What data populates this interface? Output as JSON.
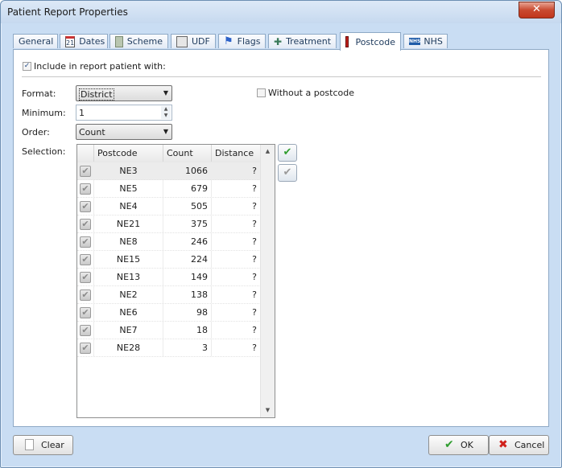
{
  "window": {
    "title": "Patient Report Properties",
    "close_glyph": "✕"
  },
  "tabs": [
    {
      "label": "General",
      "icon": "none"
    },
    {
      "label": "Dates",
      "icon": "calendar-icon",
      "icon_text": "21"
    },
    {
      "label": "Scheme",
      "icon": "scheme-icon"
    },
    {
      "label": "UDF",
      "icon": "udf-icon"
    },
    {
      "label": "Flags",
      "icon": "flag-icon"
    },
    {
      "label": "Treatment",
      "icon": "treatment-icon"
    },
    {
      "label": "Postcode",
      "icon": "postcode-icon",
      "active": true
    },
    {
      "label": "NHS",
      "icon": "nhs-icon",
      "icon_text": "NHS"
    }
  ],
  "include": {
    "label": "Include in report patient with:",
    "checked": true
  },
  "format": {
    "label": "Format:",
    "value": "District"
  },
  "without_postcode": {
    "label": "Without a postcode",
    "checked": false
  },
  "minimum": {
    "label": "Minimum:",
    "value": "1"
  },
  "order": {
    "label": "Order:",
    "value": "Count"
  },
  "selection": {
    "label": "Selection:",
    "columns": [
      "Postcode",
      "Count",
      "Distance"
    ],
    "rows": [
      {
        "postcode": "NE3",
        "count": "1066",
        "distance": "?",
        "selected": true
      },
      {
        "postcode": "NE5",
        "count": "679",
        "distance": "?"
      },
      {
        "postcode": "NE4",
        "count": "505",
        "distance": "?"
      },
      {
        "postcode": "NE21",
        "count": "375",
        "distance": "?"
      },
      {
        "postcode": "NE8",
        "count": "246",
        "distance": "?"
      },
      {
        "postcode": "NE15",
        "count": "224",
        "distance": "?"
      },
      {
        "postcode": "NE13",
        "count": "149",
        "distance": "?"
      },
      {
        "postcode": "NE2",
        "count": "138",
        "distance": "?"
      },
      {
        "postcode": "NE6",
        "count": "98",
        "distance": "?"
      },
      {
        "postcode": "NE7",
        "count": "18",
        "distance": "?"
      },
      {
        "postcode": "NE28",
        "count": "3",
        "distance": "?"
      }
    ]
  },
  "buttons": {
    "clear": "Clear",
    "ok": "OK",
    "cancel": "Cancel"
  },
  "colors": {
    "accent": "#2f9d2f",
    "cancel": "#d0201a",
    "window_bg": "#c9ddf3"
  }
}
